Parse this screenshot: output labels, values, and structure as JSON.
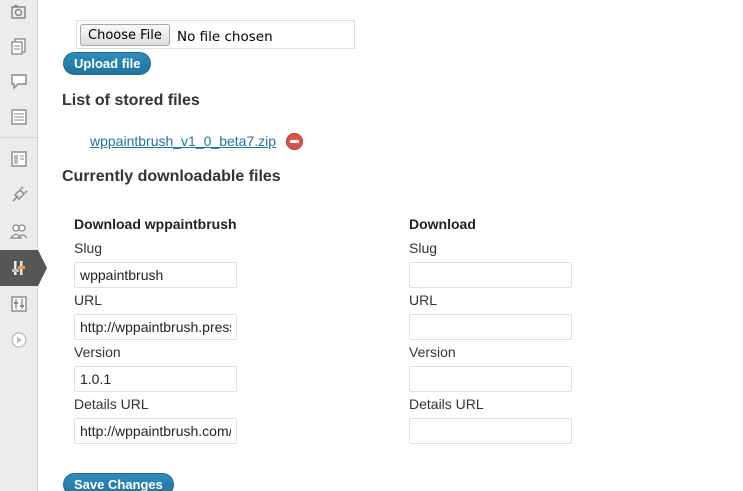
{
  "sidebar": {
    "icons": [
      "media-icon",
      "pages-icon",
      "comments-icon",
      "forms-icon",
      "appearance-icon",
      "plugins-icon",
      "users-icon",
      "tools-icon",
      "settings-icon",
      "collapse-menu-icon"
    ],
    "active_index": 7,
    "active_color": "#555555"
  },
  "upload": {
    "choose_file_label": "Choose File",
    "no_file_text": "No file chosen",
    "upload_button": "Upload file"
  },
  "stored": {
    "heading": "List of stored files",
    "files": [
      "wppaintbrush_v1_0_beta7.zip"
    ]
  },
  "downloadable": {
    "heading": "Currently downloadable files",
    "columns": [
      {
        "title": "Download wppaintbrush",
        "slug_label": "Slug",
        "slug": "wppaintbrush",
        "url_label": "URL",
        "url": "http://wppaintbrush.press",
        "version_label": "Version",
        "version": "1.0.1",
        "details_label": "Details URL",
        "details_url": "http://wppaintbrush.com/"
      },
      {
        "title": "Download",
        "slug_label": "Slug",
        "slug": "",
        "url_label": "URL",
        "url": "",
        "version_label": "Version",
        "version": "",
        "details_label": "Details URL",
        "details_url": ""
      }
    ]
  },
  "save_button": "Save Changes",
  "colors": {
    "accent": "#21759b",
    "link": "#21759b",
    "delete": "#d9534f"
  }
}
